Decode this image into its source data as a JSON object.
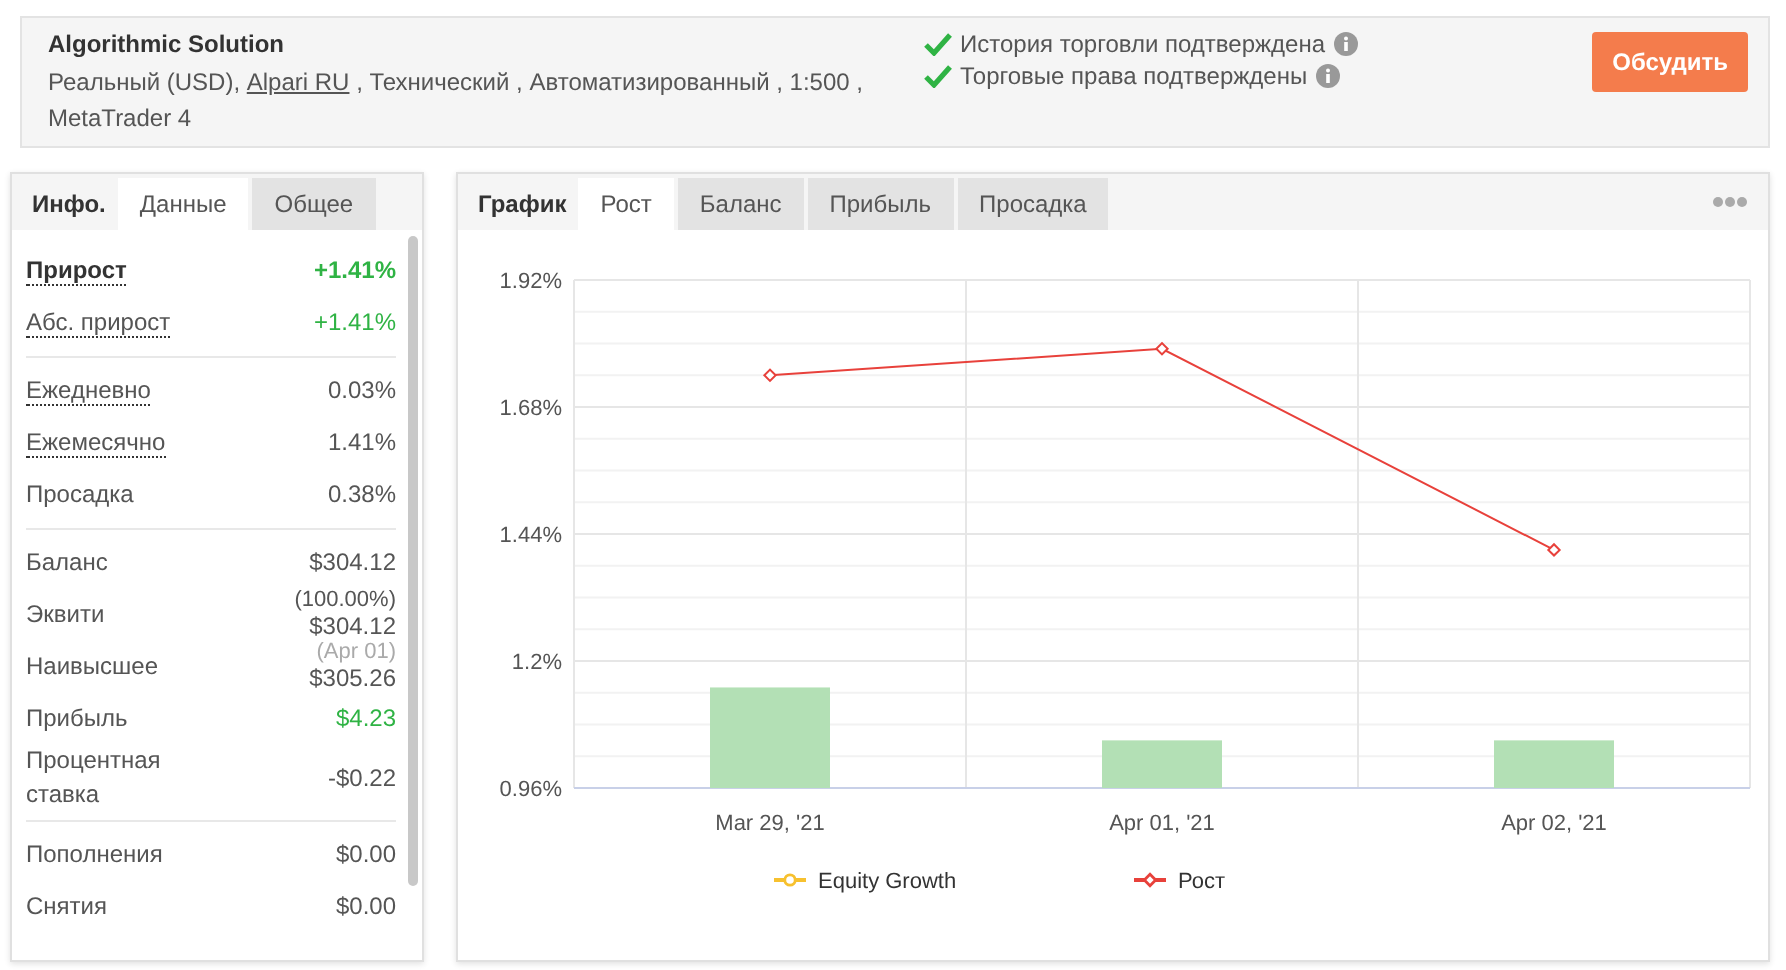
{
  "account": {
    "title": "Algorithmic Solution",
    "details_before": "Реальный (USD), ",
    "broker_link": "Alpari RU",
    "details_after": " , Технический , Автоматизированный , 1:500 , MetaTrader 4",
    "verifications": [
      {
        "text": "История торговли подтверждена",
        "verified": true
      },
      {
        "text": "Торговые права подтверждены",
        "verified": true
      }
    ],
    "action_button": "Обсудить"
  },
  "stats_panel": {
    "title": "Инфо.",
    "tabs": [
      {
        "label": "Данные",
        "selected": true
      },
      {
        "label": "Общее",
        "selected": false
      }
    ],
    "groups": [
      [
        {
          "label": "Прирост",
          "value": "+1.41%",
          "dotted": true,
          "bold": true,
          "positive": true
        },
        {
          "label": "Абс. прирост",
          "value": "+1.41%",
          "dotted": true,
          "bold": false,
          "positive": true
        }
      ],
      [
        {
          "label": "Ежедневно",
          "value": "0.03%",
          "dotted": true,
          "bold": false,
          "positive": false
        },
        {
          "label": "Ежемесячно",
          "value": "1.41%",
          "dotted": true,
          "bold": false,
          "positive": false
        },
        {
          "label": "Просадка",
          "value": "0.38%",
          "dotted": false,
          "bold": false,
          "positive": false
        }
      ],
      [
        {
          "label": "Баланс",
          "value": "$304.12",
          "dotted": false,
          "bold": false,
          "positive": false
        },
        {
          "label": "Эквити",
          "note": "(100.00%)",
          "note_muted": false,
          "value": "$304.12",
          "dotted": false,
          "bold": false,
          "positive": false
        },
        {
          "label": "Наивысшее",
          "note": "(Apr 01)",
          "note_muted": true,
          "value": "$305.26",
          "dotted": false,
          "bold": false,
          "positive": false
        },
        {
          "label": "Прибыль",
          "value": "$4.23",
          "dotted": false,
          "bold": false,
          "positive": true
        },
        {
          "label": "Процентная ставка",
          "value": "-$0.22",
          "dotted": false,
          "bold": false,
          "positive": false
        }
      ],
      [
        {
          "label": "Пополнения",
          "value": "$0.00",
          "dotted": false,
          "bold": false,
          "positive": false
        },
        {
          "label": "Снятия",
          "value": "$0.00",
          "dotted": false,
          "bold": false,
          "positive": false
        }
      ]
    ]
  },
  "chart_panel": {
    "title": "График",
    "tabs": [
      {
        "label": "Рост",
        "selected": true
      },
      {
        "label": "Баланс",
        "selected": false
      },
      {
        "label": "Прибыль",
        "selected": false
      },
      {
        "label": "Просадка",
        "selected": false
      }
    ],
    "chart_data": {
      "type": "line",
      "grid": true,
      "categories": [
        "Mar 29, '21",
        "Apr 01, '21",
        "Apr 02, '21"
      ],
      "ylim": [
        0.96,
        1.92
      ],
      "yticks": [
        {
          "value": 0.96,
          "label": "0.96%"
        },
        {
          "value": 1.2,
          "label": "1.2%"
        },
        {
          "value": 1.44,
          "label": "1.44%"
        },
        {
          "value": 1.68,
          "label": "1.68%"
        },
        {
          "value": 1.92,
          "label": "1.92%"
        }
      ],
      "series": [
        {
          "type": "bar",
          "color": "#b3e0b5",
          "values": [
            1.15,
            1.05,
            1.05
          ]
        },
        {
          "type": "line",
          "name": "Equity Growth",
          "color": "#f7c12f",
          "marker": "circle",
          "values": [
            null,
            null,
            null
          ]
        },
        {
          "type": "line",
          "name": "Рост",
          "color": "#e8413b",
          "marker": "diamond",
          "values": [
            1.74,
            1.79,
            1.41
          ]
        }
      ]
    }
  }
}
